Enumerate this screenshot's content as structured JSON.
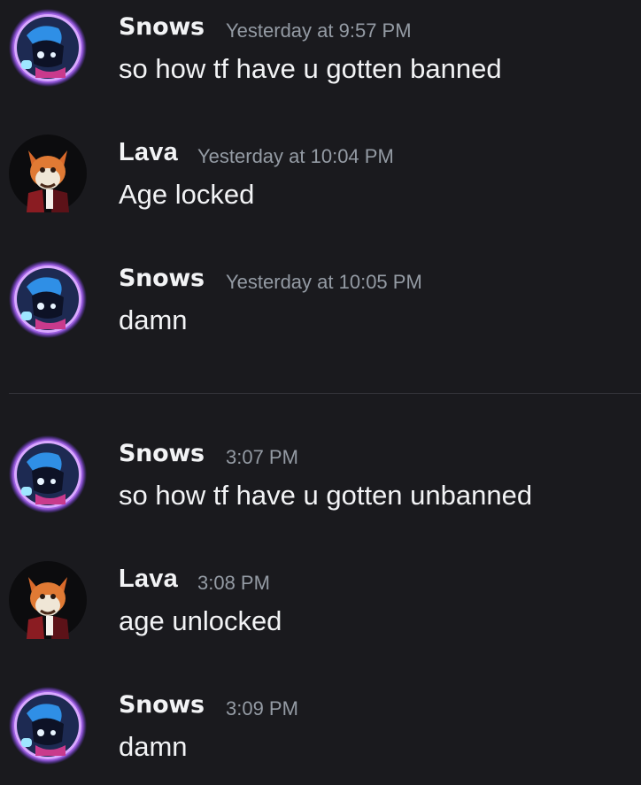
{
  "messages": [
    {
      "author": "Snows",
      "timestamp": "Yesterday at 9:57 PM",
      "text": "so how tf have u gotten banned",
      "avatar": "snows-avatar"
    },
    {
      "author": "Lava",
      "timestamp": "Yesterday at 10:04 PM",
      "text": "Age locked",
      "avatar": "lava-avatar"
    },
    {
      "author": "Snows",
      "timestamp": "Yesterday at 10:05 PM",
      "text": "damn",
      "avatar": "snows-avatar"
    },
    {
      "author": "Snows",
      "timestamp": "3:07 PM",
      "text": "so how tf have u gotten unbanned",
      "avatar": "snows-avatar"
    },
    {
      "author": "Lava",
      "timestamp": "3:08 PM",
      "text": "age unlocked",
      "avatar": "lava-avatar"
    },
    {
      "author": "Snows",
      "timestamp": "3:09 PM",
      "text": "damn",
      "avatar": "snows-avatar"
    }
  ],
  "colors": {
    "background": "#1a1a1e",
    "author_name": "#f2f3f5",
    "timestamp": "#949ba4",
    "message_text": "#f2f3f5",
    "divider": "#34353b"
  }
}
